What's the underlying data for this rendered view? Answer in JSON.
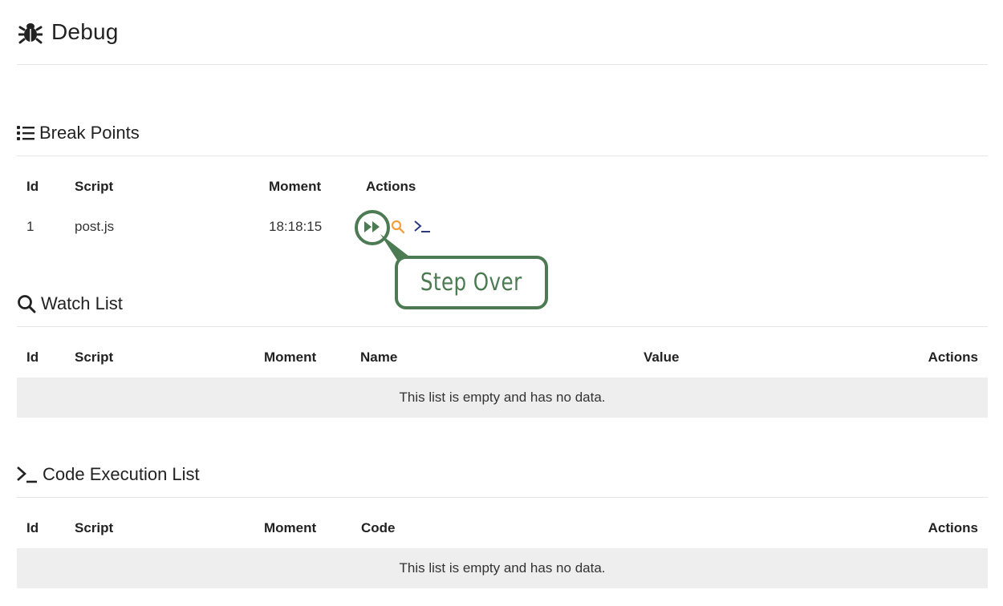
{
  "header": {
    "title": "Debug",
    "icon": "bug-icon"
  },
  "breakpoints": {
    "title": "Break Points",
    "icon": "list-icon",
    "columns": [
      "Id",
      "Script",
      "Moment",
      "Actions"
    ],
    "rows": [
      {
        "id": "1",
        "script": "post.js",
        "moment": "18:18:15",
        "actions": [
          "step-over-icon",
          "search-icon",
          "terminal-icon"
        ]
      }
    ]
  },
  "watch": {
    "title": "Watch List",
    "icon": "search-icon",
    "columns": [
      "Id",
      "Script",
      "Moment",
      "Name",
      "Value",
      "Actions"
    ],
    "empty": "This list is empty and has no data."
  },
  "code": {
    "title": "Code Execution List",
    "icon": "terminal-icon",
    "columns": [
      "Id",
      "Script",
      "Moment",
      "Code",
      "Actions"
    ],
    "empty": "This list is empty and has no data."
  },
  "callout": {
    "label": "Step Over"
  },
  "colors": {
    "callout": "#4c7a52",
    "search_action": "#f0a040",
    "terminal_action": "#2c3a80"
  }
}
